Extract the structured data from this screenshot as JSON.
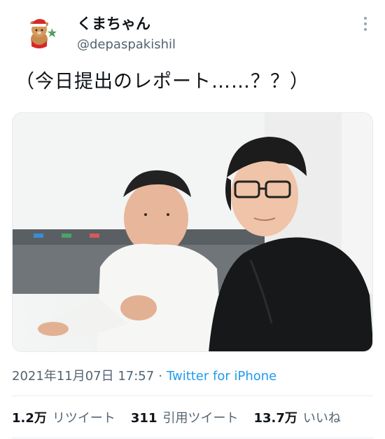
{
  "user": {
    "display_name": "くまちゃん",
    "handle": "@depaspakishil"
  },
  "tweet": {
    "text": "（今日提出のレポート……？？）"
  },
  "meta": {
    "timestamp": "2021年11月07日 17:57",
    "separator": "·",
    "source": "Twitter for iPhone"
  },
  "stats": {
    "retweets_value": "1.2万",
    "retweets_label": "リツイート",
    "quotes_value": "311",
    "quotes_label": "引用ツイート",
    "likes_value": "13.7万",
    "likes_label": "いいね"
  },
  "icons": {
    "more": "more-dots-icon",
    "avatar": "bear-santa-avatar"
  },
  "colors": {
    "accent": "#1d9bf0",
    "secondary_text": "#536471",
    "primary_text": "#0f1419"
  }
}
